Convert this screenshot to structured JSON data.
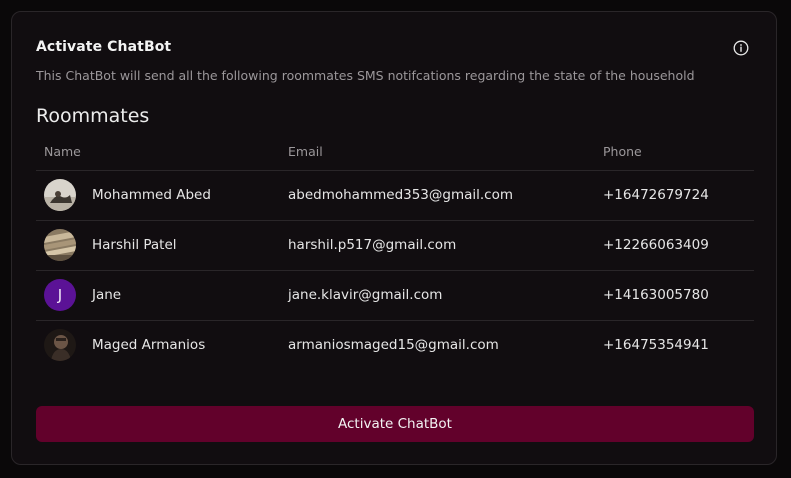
{
  "card": {
    "title": "Activate ChatBot",
    "info_icon": "info-circle-icon",
    "subtitle": "This ChatBot will send all the following roommates SMS notifcations regarding the state of the household",
    "section_title": "Roommates"
  },
  "table": {
    "headers": {
      "name": "Name",
      "email": "Email",
      "phone": "Phone"
    },
    "rows": [
      {
        "name": "Mohammed Abed",
        "email": "abedmohammed353@gmail.com",
        "phone": "+16472679724",
        "avatar": "photo"
      },
      {
        "name": "Harshil Patel",
        "email": "harshil.p517@gmail.com",
        "phone": "+12266063409",
        "avatar": "photo"
      },
      {
        "name": "Jane",
        "email": "jane.klavir@gmail.com",
        "phone": "+14163005780",
        "avatar": "letter",
        "initial": "J"
      },
      {
        "name": "Maged Armanios",
        "email": "armaniosmaged15@gmail.com",
        "phone": "+16475354941",
        "avatar": "photo"
      }
    ]
  },
  "actions": {
    "activate_label": "Activate ChatBot"
  },
  "colors": {
    "background": "#0a0809",
    "card": "#110d10",
    "button": "#62012b",
    "avatar_letter_bg": "#5b1296"
  }
}
